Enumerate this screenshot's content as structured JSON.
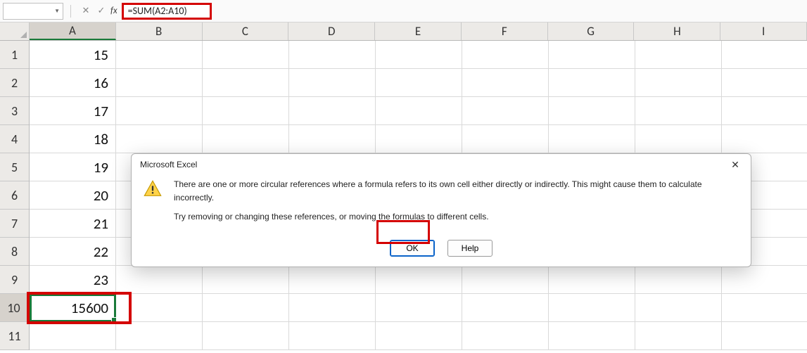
{
  "formula_bar": {
    "name_box": "",
    "fx_label": "fx",
    "formula": "=SUM(A2:A10)"
  },
  "columns": [
    "A",
    "B",
    "C",
    "D",
    "E",
    "F",
    "G",
    "H",
    "I"
  ],
  "rows": [
    1,
    2,
    3,
    4,
    5,
    6,
    7,
    8,
    9,
    10,
    11
  ],
  "cells": {
    "A1": "15",
    "A2": "16",
    "A3": "17",
    "A4": "18",
    "A5": "19",
    "A6": "20",
    "A7": "21",
    "A8": "22",
    "A9": "23",
    "A10": "15600"
  },
  "active_cell": "A10",
  "highlight": {
    "color": "#d40000",
    "formula_box": true,
    "active_cell_box": true,
    "ok_button_box": true
  },
  "dialog": {
    "title": "Microsoft Excel",
    "line1": "There are one or more circular references where a formula refers to its own cell either directly or indirectly. This might cause them to calculate incorrectly.",
    "line2": "Try removing or changing these references, or moving the formulas to different cells.",
    "ok": "OK",
    "help": "Help"
  }
}
